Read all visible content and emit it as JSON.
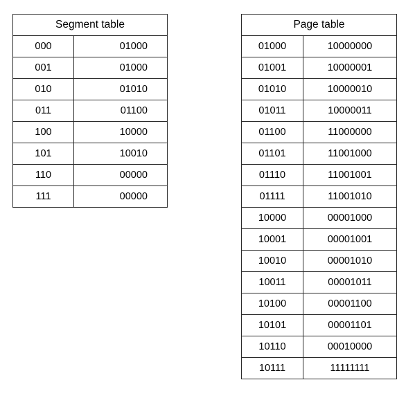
{
  "document": {
    "background_color": "#ffffff",
    "border_color": "#2a2a2a",
    "text_color": "#000000"
  },
  "segment_table": {
    "title": "Segment table",
    "rows": [
      {
        "key": "000",
        "value": "01000"
      },
      {
        "key": "001",
        "value": "01000"
      },
      {
        "key": "010",
        "value": "01010"
      },
      {
        "key": "011",
        "value": "01100"
      },
      {
        "key": "100",
        "value": "10000"
      },
      {
        "key": "101",
        "value": "10010"
      },
      {
        "key": "110",
        "value": "00000"
      },
      {
        "key": "111",
        "value": "00000"
      }
    ]
  },
  "page_table": {
    "title": "Page table",
    "rows": [
      {
        "key": "01000",
        "value": "10000000"
      },
      {
        "key": "01001",
        "value": "10000001"
      },
      {
        "key": "01010",
        "value": "10000010"
      },
      {
        "key": "01011",
        "value": "10000011"
      },
      {
        "key": "01100",
        "value": "11000000"
      },
      {
        "key": "01101",
        "value": "11001000"
      },
      {
        "key": "01110",
        "value": "11001001"
      },
      {
        "key": "01111",
        "value": "11001010"
      },
      {
        "key": "10000",
        "value": "00001000"
      },
      {
        "key": "10001",
        "value": "00001001"
      },
      {
        "key": "10010",
        "value": "00001010"
      },
      {
        "key": "10011",
        "value": "00001011"
      },
      {
        "key": "10100",
        "value": "00001100"
      },
      {
        "key": "10101",
        "value": "00001101"
      },
      {
        "key": "10110",
        "value": "00010000"
      },
      {
        "key": "10111",
        "value": "11111111"
      }
    ]
  }
}
